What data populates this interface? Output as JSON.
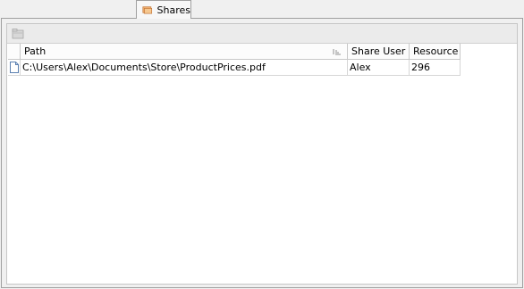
{
  "tabs": [
    {
      "label": "Shares",
      "icon": "shares-folder-icon",
      "active": true
    }
  ],
  "toolbar": {
    "buttons": [
      {
        "icon": "folder-icon",
        "enabled": false
      }
    ]
  },
  "grid": {
    "columns": [
      "Path",
      "Share User",
      "Resource II"
    ],
    "rows": [
      {
        "icon": "file-icon",
        "path": "C:\\Users\\Alex\\Documents\\Store\\ProductPrices.pdf",
        "user": "Alex",
        "resource_id": "296"
      }
    ]
  },
  "colors": {
    "accent_icon": "#e8a060",
    "border": "#a0a0a0"
  }
}
